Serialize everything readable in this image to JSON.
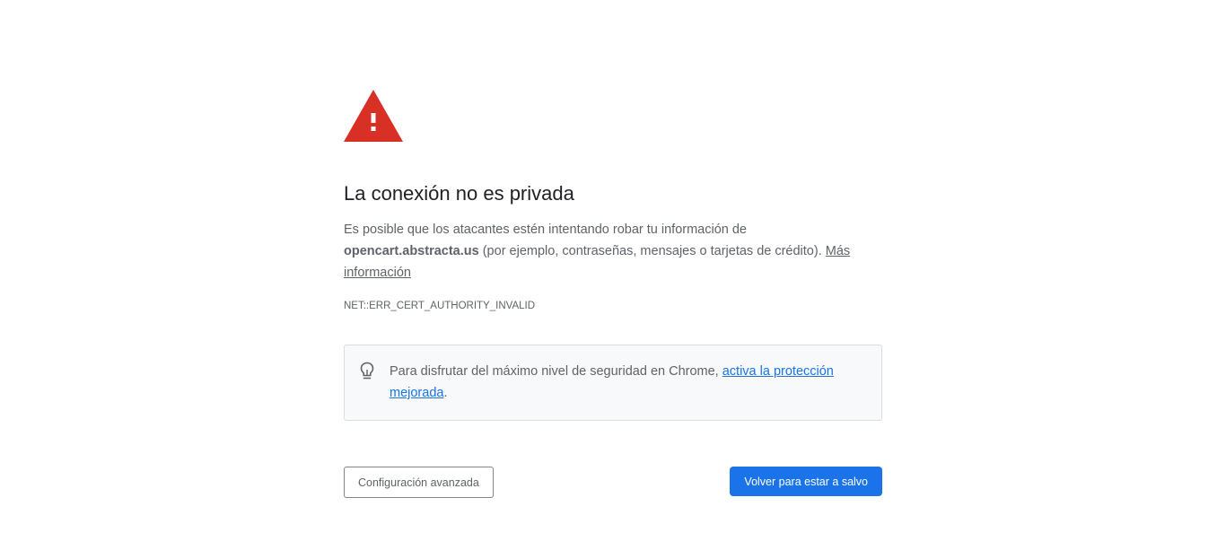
{
  "interstitial": {
    "title": "La conexión no es privada",
    "message": {
      "part1": "Es posible que los atacantes estén intentando robar tu información de ",
      "host": "opencart.abstracta.us",
      "part2": " (por ejemplo, contraseñas, mensajes o tarjetas de crédito). ",
      "learn_more_link": "Más información"
    },
    "error_code": "NET::ERR_CERT_AUTHORITY_INVALID",
    "promo": {
      "icon": "lightbulb-icon",
      "text_before": "Para disfrutar del máximo nivel de seguridad en Chrome, ",
      "link": "activa la protección mejorada",
      "text_after": "."
    },
    "buttons": {
      "advanced": "Configuración avanzada",
      "back_to_safety": "Volver para estar a salvo"
    }
  },
  "colors": {
    "warning_red": "#d93025",
    "primary_blue": "#1a73e8",
    "text_gray": "#5f6368",
    "title_dark": "#202124",
    "promo_bg": "#f8f9fa"
  },
  "icons": {
    "warning": "warning-triangle-icon",
    "bulb": "lightbulb-icon"
  }
}
